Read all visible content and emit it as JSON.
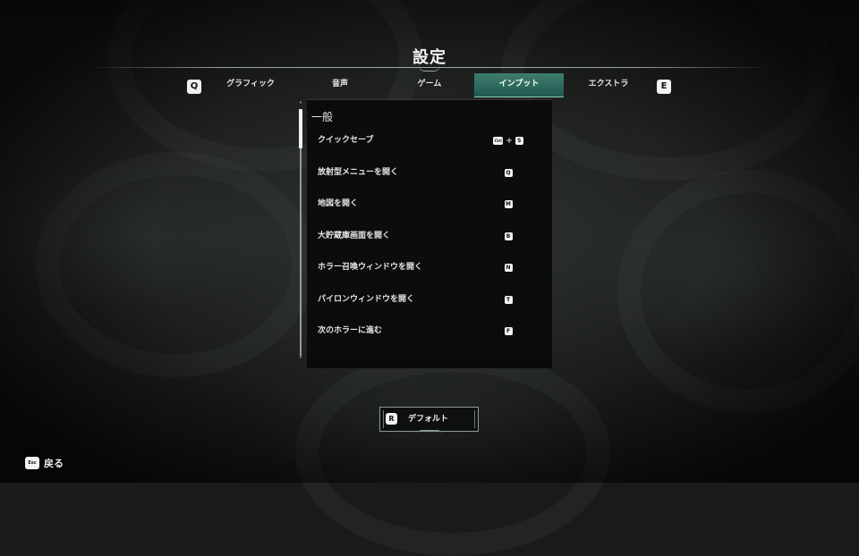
{
  "title": "設定",
  "tabs": {
    "prev_key": "Q",
    "next_key": "E",
    "items": [
      {
        "label": "グラフィック"
      },
      {
        "label": "音声"
      },
      {
        "label": "ゲーム"
      },
      {
        "label": "インプット",
        "active": true
      },
      {
        "label": "エクストラ"
      }
    ]
  },
  "section": {
    "header": "一般",
    "rows": [
      {
        "label": "クイックセーブ",
        "keys": [
          "Ctrl",
          "S"
        ]
      },
      {
        "label": "放射型メニューを開く",
        "keys": [
          "Q"
        ]
      },
      {
        "label": "地図を開く",
        "keys": [
          "M"
        ]
      },
      {
        "label": "大貯蔵庫画面を開く",
        "keys": [
          "B"
        ]
      },
      {
        "label": "ホラー召喚ウィンドウを開く",
        "keys": [
          "N"
        ]
      },
      {
        "label": "パイロンウィンドウを開く",
        "keys": [
          "T"
        ]
      },
      {
        "label": "次のホラーに進む",
        "keys": [
          "F"
        ]
      }
    ],
    "plus": "+"
  },
  "default_button": {
    "key": "R",
    "label": "デフォルト"
  },
  "back": {
    "key": "Esc",
    "label": "戻る"
  },
  "colors": {
    "accent": "#2e6b5e",
    "accent_border": "#8fd0c0",
    "panel": "#0a0a0a"
  }
}
